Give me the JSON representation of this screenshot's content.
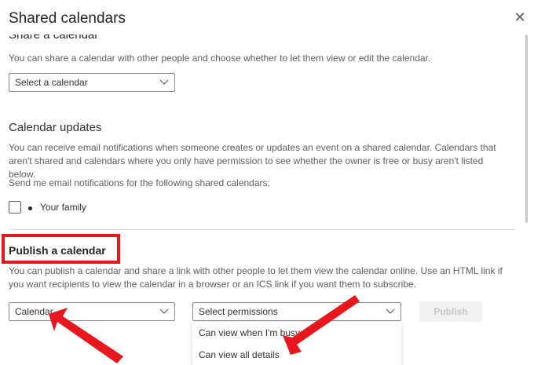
{
  "header": {
    "title": "Shared calendars",
    "close_glyph": "✕"
  },
  "share": {
    "heading": "Share a calendar",
    "description": "You can share a calendar with other people and choose whether to let them view or edit the calendar.",
    "select_label": "Select a calendar"
  },
  "updates": {
    "heading": "Calendar updates",
    "description": "You can receive email notifications when someone creates or updates an event on a shared calendar. Calendars that aren't shared and calendars where you only have permission to see whether the owner is free or busy aren't listed below.",
    "prompt": "Send me email notifications for the following shared calendars:",
    "calendars": [
      {
        "name": "Your family",
        "checked": false
      }
    ]
  },
  "publish": {
    "heading": "Publish a calendar",
    "description": "You can publish a calendar and share a link with other people to let them view the calendar online. Use an HTML link if you want recipients to view the calendar in a browser or an ICS link if you want them to subscribe.",
    "calendar_select": "Calendar",
    "permissions_placeholder": "Select permissions",
    "publish_button": "Publish",
    "permission_options": [
      "Can view when I'm busy",
      "Can view all details"
    ]
  },
  "colors": {
    "highlight": "#e8161d",
    "accent_text": "#323130"
  }
}
